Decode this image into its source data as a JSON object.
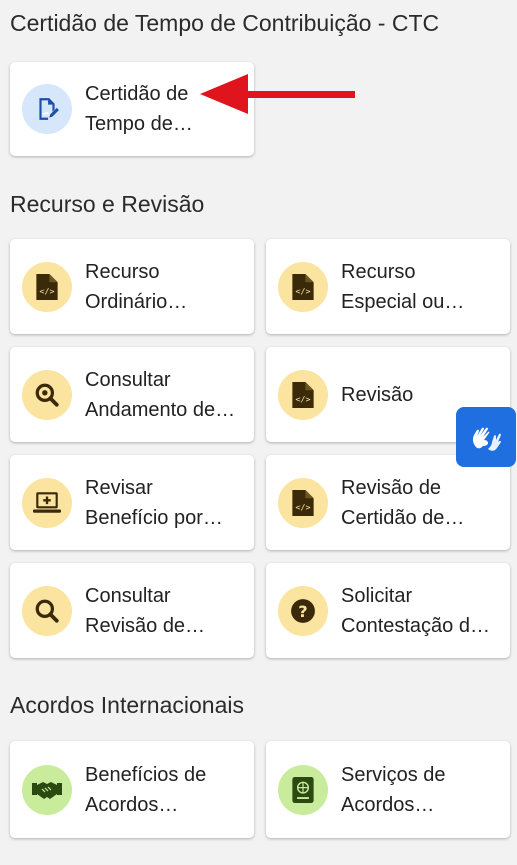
{
  "sections": {
    "ctc": {
      "title": "Certidão de Tempo de Contribuição - CTC",
      "cards": [
        {
          "line1": "Certidão de",
          "line2": "Tempo de…",
          "icon": "document-signature-icon"
        }
      ]
    },
    "recurso": {
      "title": "Recurso e Revisão",
      "cards": [
        {
          "line1": "Recurso",
          "line2": "Ordinário…",
          "icon": "file-code-icon"
        },
        {
          "line1": "Recurso",
          "line2": "Especial ou…",
          "icon": "file-code-icon"
        },
        {
          "line1": "Consultar",
          "line2": "Andamento de…",
          "icon": "search-magnify-icon"
        },
        {
          "line1": "Revisão",
          "line2": "",
          "icon": "file-code-icon"
        },
        {
          "line1": "Revisar",
          "line2": "Benefício por…",
          "icon": "monitor-plus-icon"
        },
        {
          "line1": "Revisão de",
          "line2": "Certidão de…",
          "icon": "file-code-icon"
        },
        {
          "line1": "Consultar",
          "line2": "Revisão de…",
          "icon": "search-icon"
        },
        {
          "line1": "Solicitar",
          "line2": "Contestação d…",
          "icon": "question-circle-icon"
        }
      ]
    },
    "acordos": {
      "title": "Acordos Internacionais",
      "cards": [
        {
          "line1": "Benefícios de",
          "line2": "Acordos…",
          "icon": "handshake-icon"
        },
        {
          "line1": "Serviços de",
          "line2": "Acordos…",
          "icon": "passport-icon"
        }
      ]
    }
  },
  "colors": {
    "yellow_circle": "#fbe3a0",
    "blue_circle": "#d6e6fb",
    "green_circle": "#c9ec9c",
    "arrow": "#e0141c",
    "libras_button": "#1f6fe0"
  }
}
